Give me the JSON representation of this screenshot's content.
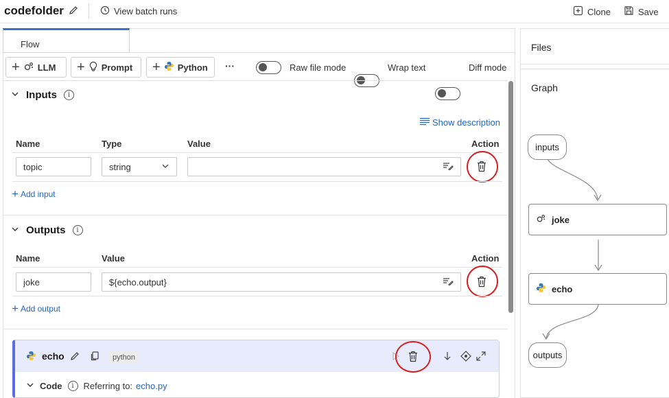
{
  "header": {
    "title": "codefolder",
    "view_batch_runs": "View batch runs",
    "clone": "Clone",
    "save": "Save"
  },
  "tabs": {
    "flow": "Flow"
  },
  "toolbar": {
    "llm": "LLM",
    "prompt": "Prompt",
    "python": "Python",
    "more": "···",
    "raw_file_mode": "Raw file mode",
    "wrap_text": "Wrap text",
    "diff_mode": "Diff mode"
  },
  "inputs": {
    "heading": "Inputs",
    "show_description": "Show description",
    "col_name": "Name",
    "col_type": "Type",
    "col_value": "Value",
    "col_action": "Action",
    "row": {
      "name": "topic",
      "type": "string",
      "value": ""
    },
    "add": "Add input"
  },
  "outputs": {
    "heading": "Outputs",
    "col_name": "Name",
    "col_value": "Value",
    "col_action": "Action",
    "row": {
      "name": "joke",
      "value": "${echo.output}"
    },
    "add": "Add output"
  },
  "node_card": {
    "name": "echo",
    "chip": "python",
    "code_label": "Code",
    "referring_to": "Referring to:",
    "file": "echo.py"
  },
  "right": {
    "files": "Files",
    "graph": "Graph",
    "nodes": {
      "inputs": "inputs",
      "joke": "joke",
      "echo": "echo",
      "outputs": "outputs"
    }
  },
  "colors": {
    "accent": "#2266c2",
    "highlight": "#d42020",
    "node_border": "#5b6ee1"
  }
}
